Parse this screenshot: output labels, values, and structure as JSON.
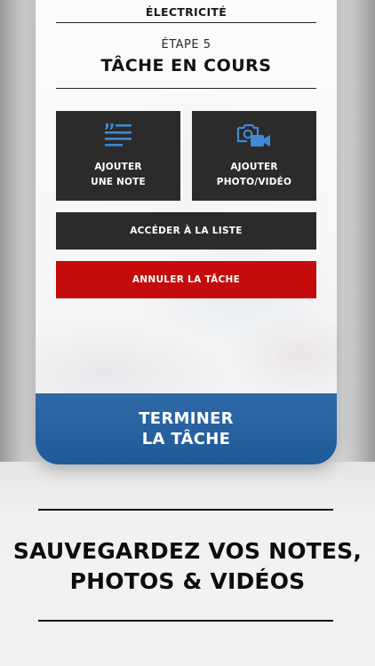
{
  "header": {
    "category": "ÉLECTRICITÉ",
    "step": "ÉTAPE 5",
    "title": "TÂCHE EN COURS"
  },
  "actions": {
    "add_note": {
      "line1": "AJOUTER",
      "line2": "UNE NOTE",
      "icon": "note-lines-icon"
    },
    "add_media": {
      "line1": "AJOUTER",
      "line2": "PHOTO/VIDÉO",
      "icon": "camera-video-icon"
    },
    "list_label": "ACCÉDER À LA LISTE",
    "cancel_label": "ANNULER LA TÂCHE",
    "finish": {
      "line1": "TERMINER",
      "line2": "LA TÂCHE"
    }
  },
  "promo": {
    "line1": "SAUVEGARDEZ VOS NOTES,",
    "line2": "PHOTOS & VIDÉOS"
  },
  "colors": {
    "accent_blue": "#2a64a3",
    "danger_red": "#c50b0b",
    "tile_dark": "#2b2b2b",
    "icon_blue": "#3f8ad6"
  }
}
